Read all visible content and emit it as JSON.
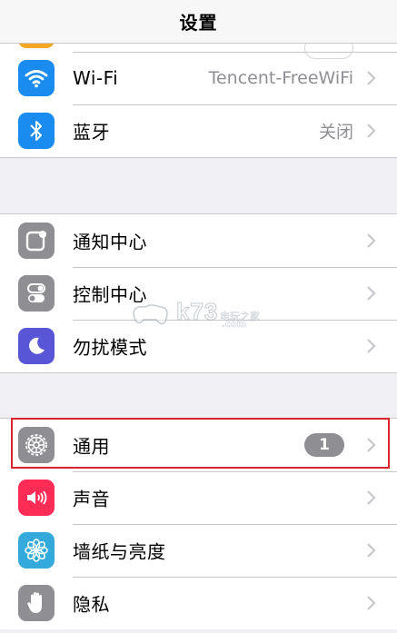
{
  "navbar": {
    "title": "设置"
  },
  "group1": {
    "rows": [
      {
        "label": "Wi-Fi",
        "value": "Tencent-FreeWiFi",
        "icon": "wifi-icon",
        "color": "#1a8cf0"
      },
      {
        "label": "蓝牙",
        "value": "关闭",
        "icon": "bluetooth-icon",
        "color": "#1a8cf0"
      }
    ],
    "partial_row_icon_color": "#f5a623"
  },
  "group2": {
    "rows": [
      {
        "label": "通知中心",
        "icon": "notification-center-icon",
        "color": "#8e8e93"
      },
      {
        "label": "控制中心",
        "icon": "control-center-icon",
        "color": "#8e8e93"
      },
      {
        "label": "勿扰模式",
        "icon": "moon-icon",
        "color": "#5856d6"
      }
    ]
  },
  "group3": {
    "rows": [
      {
        "label": "通用",
        "badge": "1",
        "icon": "gear-icon",
        "color": "#8e8e93"
      },
      {
        "label": "声音",
        "icon": "speaker-icon",
        "color": "#ff2d55"
      },
      {
        "label": "墙纸与亮度",
        "icon": "wallpaper-flower-icon",
        "color": "#34aadc"
      },
      {
        "label": "隐私",
        "icon": "hand-icon",
        "color": "#8e8e93"
      }
    ]
  },
  "highlight_color": "#d9232f",
  "watermark": {
    "text": "k73",
    "sub": "电玩之家",
    "domain": ".com"
  }
}
